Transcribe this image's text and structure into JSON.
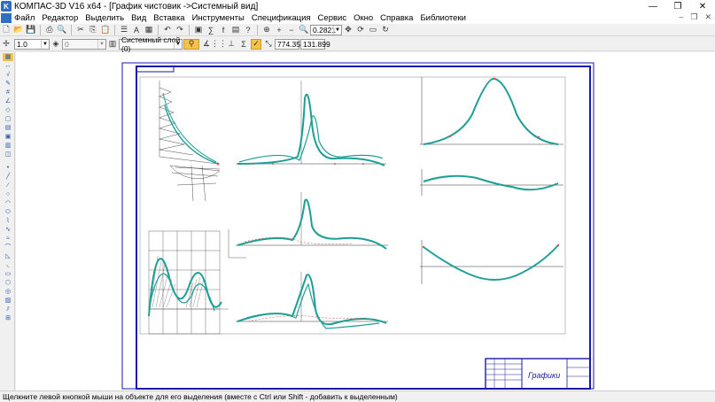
{
  "window": {
    "title": "КОМПАС-3D V16 x64 - [График чистовик ->Системный вид]",
    "controls": [
      "—",
      "❐",
      "✕"
    ]
  },
  "menu": {
    "items": [
      "Файл",
      "Редактор",
      "Выделить",
      "Вид",
      "Вставка",
      "Инструменты",
      "Спецификация",
      "Сервис",
      "Окно",
      "Справка",
      "Библиотеки"
    ],
    "mdi_controls": [
      "–",
      "❐",
      "✕"
    ]
  },
  "toolbar1": {
    "zoom_value": "0.2821"
  },
  "toolbar2": {
    "line_scale": "1.0",
    "layer_number": "0",
    "layer_name": "Системный слой (0)",
    "coord_x": "774.353",
    "coord_y": "131.899"
  },
  "drawing": {
    "title_block_text": "Графики"
  },
  "status": {
    "message": "Щелкните левой кнопкой мыши на объекте для его выделения (вместе с Ctrl или Shift - добавить к выделенным)"
  },
  "colors": {
    "frame": "#1a1aa8",
    "curve": "#1f9e96",
    "marker": "#e05050"
  }
}
